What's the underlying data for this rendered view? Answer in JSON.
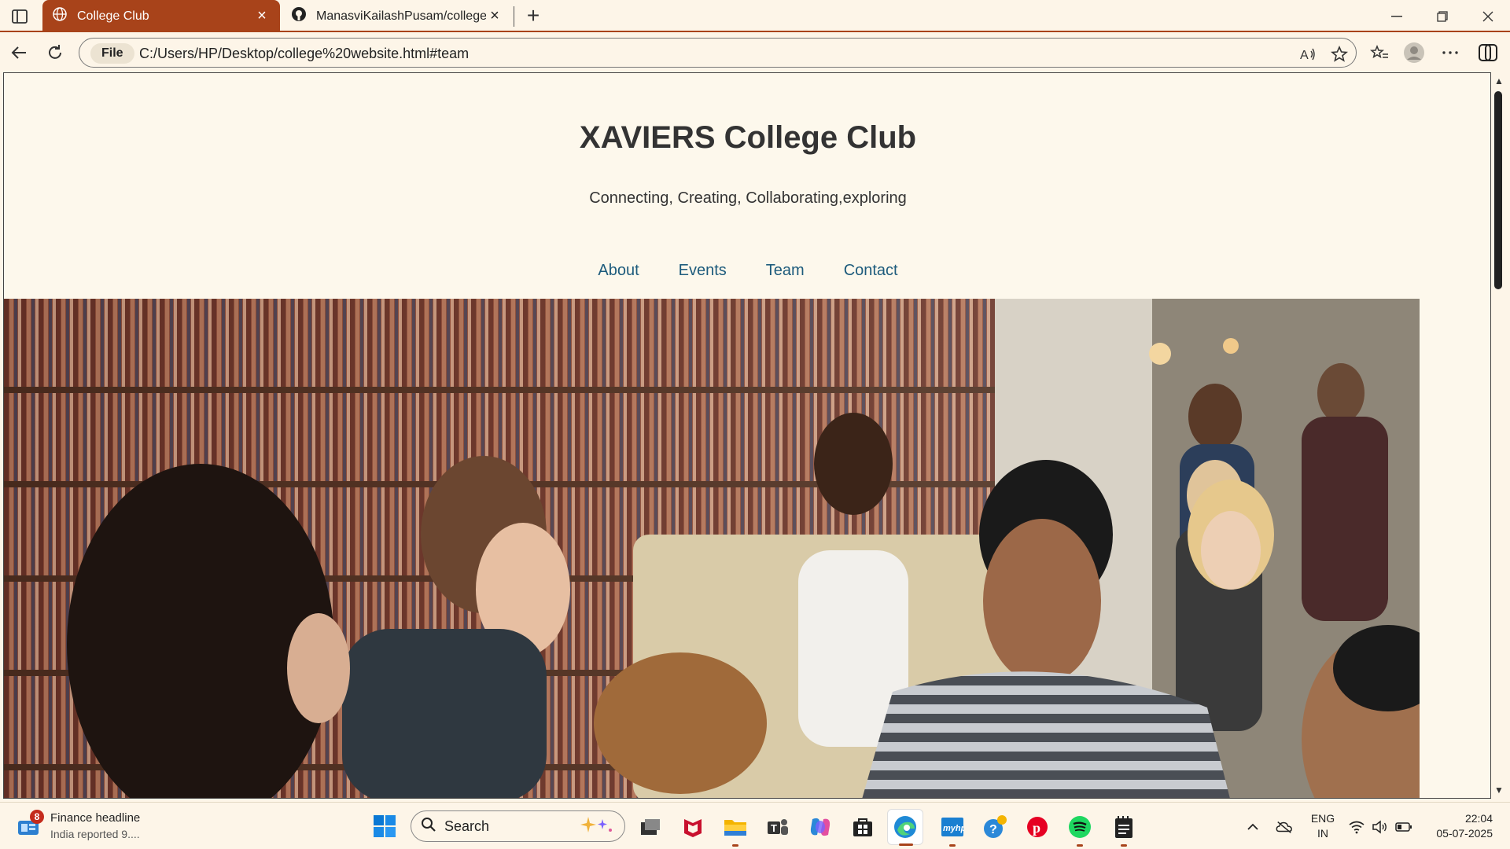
{
  "browser": {
    "tabs": [
      {
        "title": "College Club",
        "active": true
      },
      {
        "title": "ManasviKailashPusam/college--cl",
        "active": false
      }
    ],
    "address": {
      "scheme": "File",
      "url": "C:/Users/HP/Desktop/college%20website.html#team"
    },
    "accent": "#a8431a"
  },
  "page": {
    "title": "XAVIERS College Club",
    "tagline": "Connecting, Creating, Collaborating,exploring",
    "nav": [
      "About",
      "Events",
      "Team",
      "Contact"
    ],
    "link_color": "#1d5b7c"
  },
  "taskbar": {
    "news": {
      "badge": "8",
      "title": "Finance headline",
      "subtitle": "India reported 9...."
    },
    "search_label": "Search",
    "language": {
      "line1": "ENG",
      "line2": "IN"
    },
    "clock": {
      "time": "22:04",
      "date": "05-07-2025"
    }
  }
}
